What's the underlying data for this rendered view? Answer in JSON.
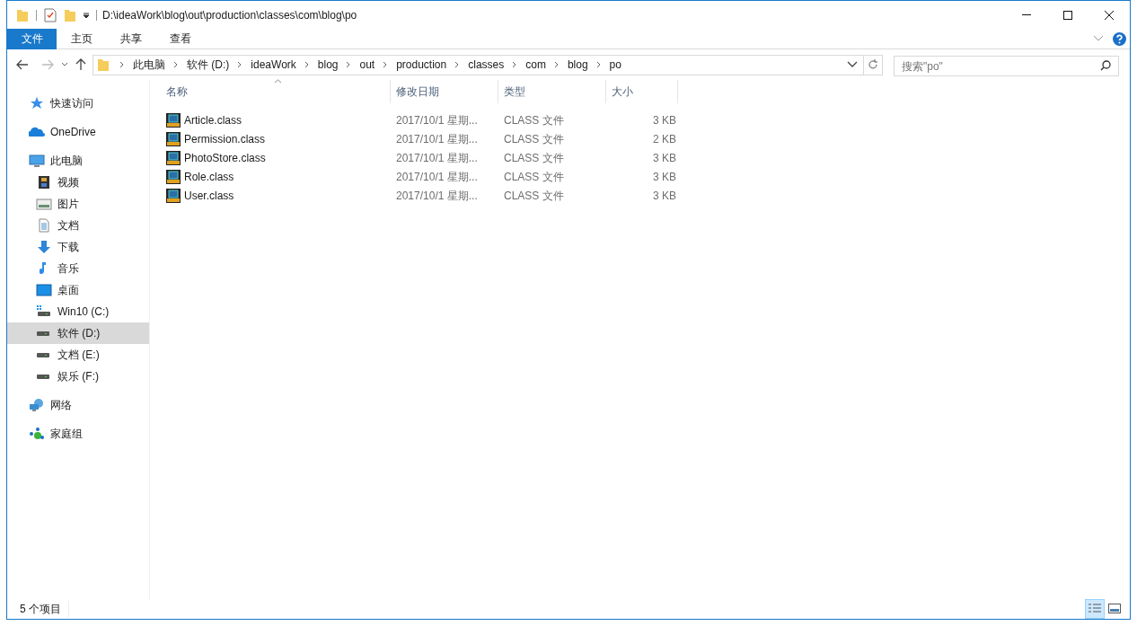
{
  "window": {
    "title": "D:\\ideaWork\\blog\\out\\production\\classes\\com\\blog\\po"
  },
  "ribbon_tabs": [
    {
      "label": "文件",
      "selected": true
    },
    {
      "label": "主页",
      "selected": false
    },
    {
      "label": "共享",
      "selected": false
    },
    {
      "label": "查看",
      "selected": false
    }
  ],
  "breadcrumb": [
    "此电脑",
    "软件 (D:)",
    "ideaWork",
    "blog",
    "out",
    "production",
    "classes",
    "com",
    "blog",
    "po"
  ],
  "search": {
    "placeholder": "搜索\"po\""
  },
  "sidebar": {
    "items": [
      {
        "label": "快速访问",
        "kind": "star",
        "selected": false
      },
      {
        "label": "OneDrive",
        "kind": "cloud",
        "selected": false
      },
      {
        "label": "此电脑",
        "kind": "pc",
        "selected": false,
        "children": [
          {
            "label": "视频",
            "kind": "video",
            "selected": false
          },
          {
            "label": "图片",
            "kind": "picture",
            "selected": false
          },
          {
            "label": "文档",
            "kind": "document",
            "selected": false
          },
          {
            "label": "下载",
            "kind": "download",
            "selected": false
          },
          {
            "label": "音乐",
            "kind": "music",
            "selected": false
          },
          {
            "label": "桌面",
            "kind": "desktop",
            "selected": false
          },
          {
            "label": "Win10 (C:)",
            "kind": "windrive",
            "selected": false
          },
          {
            "label": "软件 (D:)",
            "kind": "drive",
            "selected": true
          },
          {
            "label": "文档 (E:)",
            "kind": "drive",
            "selected": false
          },
          {
            "label": "娱乐 (F:)",
            "kind": "drive",
            "selected": false
          }
        ]
      },
      {
        "label": "网络",
        "kind": "network",
        "selected": false
      },
      {
        "label": "家庭组",
        "kind": "homegroup",
        "selected": false
      }
    ]
  },
  "table": {
    "columns": [
      "名称",
      "修改日期",
      "类型",
      "大小"
    ],
    "rows": [
      {
        "name": "Article.class",
        "modified": "2017/10/1 星期...",
        "type": "CLASS 文件",
        "size": "3 KB"
      },
      {
        "name": "Permission.class",
        "modified": "2017/10/1 星期...",
        "type": "CLASS 文件",
        "size": "2 KB"
      },
      {
        "name": "PhotoStore.class",
        "modified": "2017/10/1 星期...",
        "type": "CLASS 文件",
        "size": "3 KB"
      },
      {
        "name": "Role.class",
        "modified": "2017/10/1 星期...",
        "type": "CLASS 文件",
        "size": "3 KB"
      },
      {
        "name": "User.class",
        "modified": "2017/10/1 星期...",
        "type": "CLASS 文件",
        "size": "3 KB"
      }
    ]
  },
  "status_bar": {
    "text": "5 个项目",
    "view_buttons": [
      {
        "kind": "details",
        "selected": true
      },
      {
        "kind": "thumbnails",
        "selected": false
      }
    ]
  }
}
